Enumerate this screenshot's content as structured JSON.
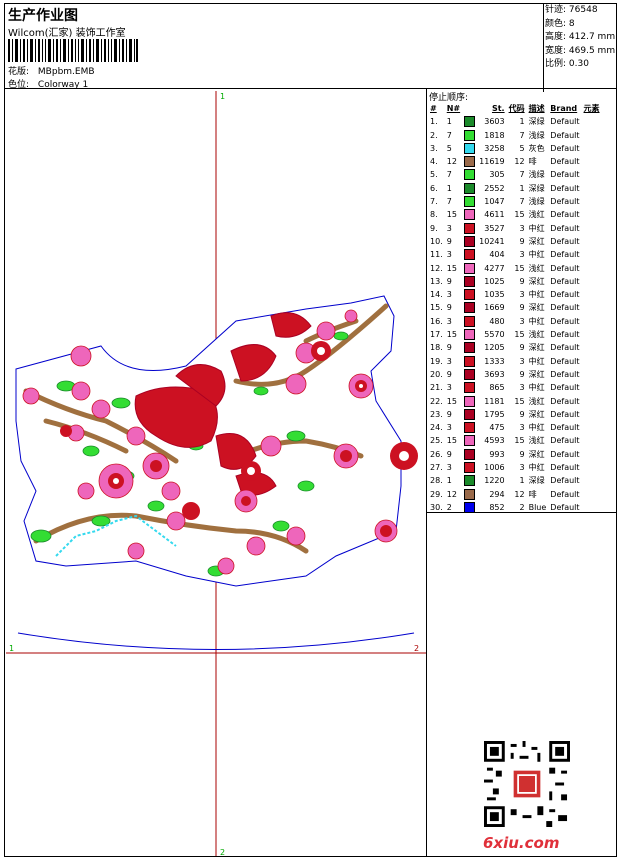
{
  "header": {
    "title": "生产作业图",
    "subtitle": "Wilcom(汇家) 装饰工作室",
    "design_label": "花版:",
    "design_value": "MBpbm.EMB",
    "colorway_label": "色位:",
    "colorway_value": "Colorway 1"
  },
  "stats": [
    {
      "label": "针迹:",
      "value": "76548"
    },
    {
      "label": "颜色:",
      "value": "8"
    },
    {
      "label": "高度:",
      "value": "412.7 mm"
    },
    {
      "label": "宽度:",
      "value": "469.5 mm"
    },
    {
      "label": "比例:",
      "value": "0.30"
    }
  ],
  "sequence": {
    "title": "停止顺序:",
    "columns": [
      "#",
      "N#",
      "St.",
      "代码",
      "描述",
      "Brand",
      "元素"
    ],
    "rows": [
      {
        "idx": "1.",
        "n": "1",
        "color": "#1a8a2a",
        "st": "3603",
        "code": "1",
        "desc": "深绿",
        "brand": "Default"
      },
      {
        "idx": "2.",
        "n": "7",
        "color": "#33dd33",
        "st": "1818",
        "code": "7",
        "desc": "浅绿",
        "brand": "Default"
      },
      {
        "idx": "3.",
        "n": "5",
        "color": "#33d9ee",
        "st": "3258",
        "code": "5",
        "desc": "灰色",
        "brand": "Default"
      },
      {
        "idx": "4.",
        "n": "12",
        "color": "#9a6a4a",
        "st": "11619",
        "code": "12",
        "desc": "啡",
        "brand": "Default"
      },
      {
        "idx": "5.",
        "n": "7",
        "color": "#33dd33",
        "st": "305",
        "code": "7",
        "desc": "浅绿",
        "brand": "Default"
      },
      {
        "idx": "6.",
        "n": "1",
        "color": "#1a8a2a",
        "st": "2552",
        "code": "1",
        "desc": "深绿",
        "brand": "Default"
      },
      {
        "idx": "7.",
        "n": "7",
        "color": "#33dd33",
        "st": "1047",
        "code": "7",
        "desc": "浅绿",
        "brand": "Default"
      },
      {
        "idx": "8.",
        "n": "15",
        "color": "#ee66bb",
        "st": "4611",
        "code": "15",
        "desc": "浅红",
        "brand": "Default"
      },
      {
        "idx": "9.",
        "n": "3",
        "color": "#cc1122",
        "st": "3527",
        "code": "3",
        "desc": "中红",
        "brand": "Default"
      },
      {
        "idx": "10.",
        "n": "9",
        "color": "#aa0022",
        "st": "10241",
        "code": "9",
        "desc": "深红",
        "brand": "Default"
      },
      {
        "idx": "11.",
        "n": "3",
        "color": "#cc1122",
        "st": "404",
        "code": "3",
        "desc": "中红",
        "brand": "Default"
      },
      {
        "idx": "12.",
        "n": "15",
        "color": "#ee66bb",
        "st": "4277",
        "code": "15",
        "desc": "浅红",
        "brand": "Default"
      },
      {
        "idx": "13.",
        "n": "9",
        "color": "#aa0022",
        "st": "1025",
        "code": "9",
        "desc": "深红",
        "brand": "Default"
      },
      {
        "idx": "14.",
        "n": "3",
        "color": "#cc1122",
        "st": "1035",
        "code": "3",
        "desc": "中红",
        "brand": "Default"
      },
      {
        "idx": "15.",
        "n": "9",
        "color": "#aa0022",
        "st": "1669",
        "code": "9",
        "desc": "深红",
        "brand": "Default"
      },
      {
        "idx": "16.",
        "n": "3",
        "color": "#cc1122",
        "st": "480",
        "code": "3",
        "desc": "中红",
        "brand": "Default"
      },
      {
        "idx": "17.",
        "n": "15",
        "color": "#ee66bb",
        "st": "5570",
        "code": "15",
        "desc": "浅红",
        "brand": "Default"
      },
      {
        "idx": "18.",
        "n": "9",
        "color": "#aa0022",
        "st": "1205",
        "code": "9",
        "desc": "深红",
        "brand": "Default"
      },
      {
        "idx": "19.",
        "n": "3",
        "color": "#cc1122",
        "st": "1333",
        "code": "3",
        "desc": "中红",
        "brand": "Default"
      },
      {
        "idx": "20.",
        "n": "9",
        "color": "#aa0022",
        "st": "3693",
        "code": "9",
        "desc": "深红",
        "brand": "Default"
      },
      {
        "idx": "21.",
        "n": "3",
        "color": "#cc1122",
        "st": "865",
        "code": "3",
        "desc": "中红",
        "brand": "Default"
      },
      {
        "idx": "22.",
        "n": "15",
        "color": "#ee66bb",
        "st": "1181",
        "code": "15",
        "desc": "浅红",
        "brand": "Default"
      },
      {
        "idx": "23.",
        "n": "9",
        "color": "#aa0022",
        "st": "1795",
        "code": "9",
        "desc": "深红",
        "brand": "Default"
      },
      {
        "idx": "24.",
        "n": "3",
        "color": "#cc1122",
        "st": "475",
        "code": "3",
        "desc": "中红",
        "brand": "Default"
      },
      {
        "idx": "25.",
        "n": "15",
        "color": "#ee66bb",
        "st": "4593",
        "code": "15",
        "desc": "浅红",
        "brand": "Default"
      },
      {
        "idx": "26.",
        "n": "9",
        "color": "#aa0022",
        "st": "993",
        "code": "9",
        "desc": "深红",
        "brand": "Default"
      },
      {
        "idx": "27.",
        "n": "3",
        "color": "#cc1122",
        "st": "1006",
        "code": "3",
        "desc": "中红",
        "brand": "Default"
      },
      {
        "idx": "28.",
        "n": "1",
        "color": "#1a8a2a",
        "st": "1220",
        "code": "1",
        "desc": "深绿",
        "brand": "Default"
      },
      {
        "idx": "29.",
        "n": "12",
        "color": "#9a6a4a",
        "st": "294",
        "code": "12",
        "desc": "啡",
        "brand": "Default"
      },
      {
        "idx": "30.",
        "n": "2",
        "color": "#0000ee",
        "st": "852",
        "code": "2",
        "desc": "Blue",
        "brand": "Default"
      }
    ]
  },
  "axis_labels": {
    "top": "1",
    "bottom": "2",
    "left": "1",
    "right": "2"
  },
  "watermark": "6xiu.com"
}
